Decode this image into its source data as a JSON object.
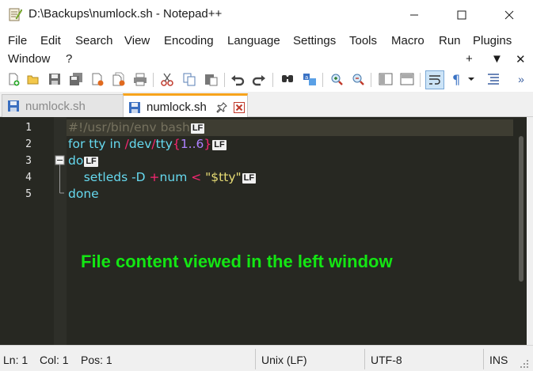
{
  "title_bar": {
    "title": "D:\\Backups\\numlock.sh - Notepad++",
    "app_icon": "notepad-icon",
    "buttons": [
      "minimize",
      "maximize",
      "close"
    ]
  },
  "menu": {
    "items": [
      {
        "label": "File"
      },
      {
        "label": "Edit"
      },
      {
        "label": "Search"
      },
      {
        "label": "View"
      },
      {
        "label": "Encoding"
      },
      {
        "label": "Language"
      },
      {
        "label": "Settings"
      },
      {
        "label": "Tools"
      },
      {
        "label": "Macro"
      },
      {
        "label": "Run"
      },
      {
        "label": "Plugins"
      },
      {
        "label": "Window"
      },
      {
        "label": "?"
      }
    ],
    "right_controls": [
      "+",
      "▼",
      "✕"
    ]
  },
  "toolbar": {
    "icons": [
      "new-file",
      "open-file",
      "save",
      "save-all",
      "close",
      "close-all",
      "print",
      "cut",
      "copy",
      "paste",
      "undo",
      "redo",
      "find",
      "replace",
      "zoom-in",
      "zoom-out",
      "sync-vertical",
      "sync-horizontal",
      "word-wrap",
      "show-all-characters",
      "indent-guide",
      "more"
    ]
  },
  "tabs": [
    {
      "label": "numlock.sh",
      "active": false
    },
    {
      "label": "numlock.sh",
      "active": true
    }
  ],
  "editor": {
    "line_numbers": [
      "1",
      "2",
      "3",
      "4",
      "5"
    ],
    "lines": [
      {
        "segments": [
          {
            "text": "#!/usr/bin/env bash",
            "cls": "c-comment"
          }
        ],
        "eol": "LF"
      },
      {
        "segments": [
          {
            "text": "for",
            "cls": "c-kw"
          },
          {
            "text": " tty ",
            "cls": "c-plain"
          },
          {
            "text": "in",
            "cls": "c-kw"
          },
          {
            "text": " ",
            "cls": "c-plain"
          },
          {
            "text": "/",
            "cls": "c-op"
          },
          {
            "text": "dev",
            "cls": "c-plain"
          },
          {
            "text": "/",
            "cls": "c-op"
          },
          {
            "text": "tty",
            "cls": "c-plain"
          },
          {
            "text": "{",
            "cls": "c-op"
          },
          {
            "text": "1..6",
            "cls": "c-num"
          },
          {
            "text": "}",
            "cls": "c-op"
          }
        ],
        "eol": "LF"
      },
      {
        "segments": [
          {
            "text": "do",
            "cls": "c-kw"
          }
        ],
        "eol": "LF"
      },
      {
        "segments": [
          {
            "text": "    setleds -D ",
            "cls": "c-plain"
          },
          {
            "text": "+",
            "cls": "c-op"
          },
          {
            "text": "num ",
            "cls": "c-plain"
          },
          {
            "text": "<",
            "cls": "c-op"
          },
          {
            "text": " ",
            "cls": "c-plain"
          },
          {
            "text": "\"$tty\"",
            "cls": "c-str"
          }
        ],
        "eol": "LF"
      },
      {
        "segments": [
          {
            "text": "done",
            "cls": "c-kw"
          }
        ],
        "eol": ""
      }
    ],
    "overlay_note": "File content viewed in the left window",
    "colors": {
      "background": "#272822",
      "note": "#13e613",
      "tab_accent": "#f7a41d"
    }
  },
  "status_bar": {
    "ln": "Ln: 1",
    "col": "Col: 1",
    "pos": "Pos: 1",
    "eol": "Unix (LF)",
    "encoding": "UTF-8",
    "mode": "INS"
  }
}
